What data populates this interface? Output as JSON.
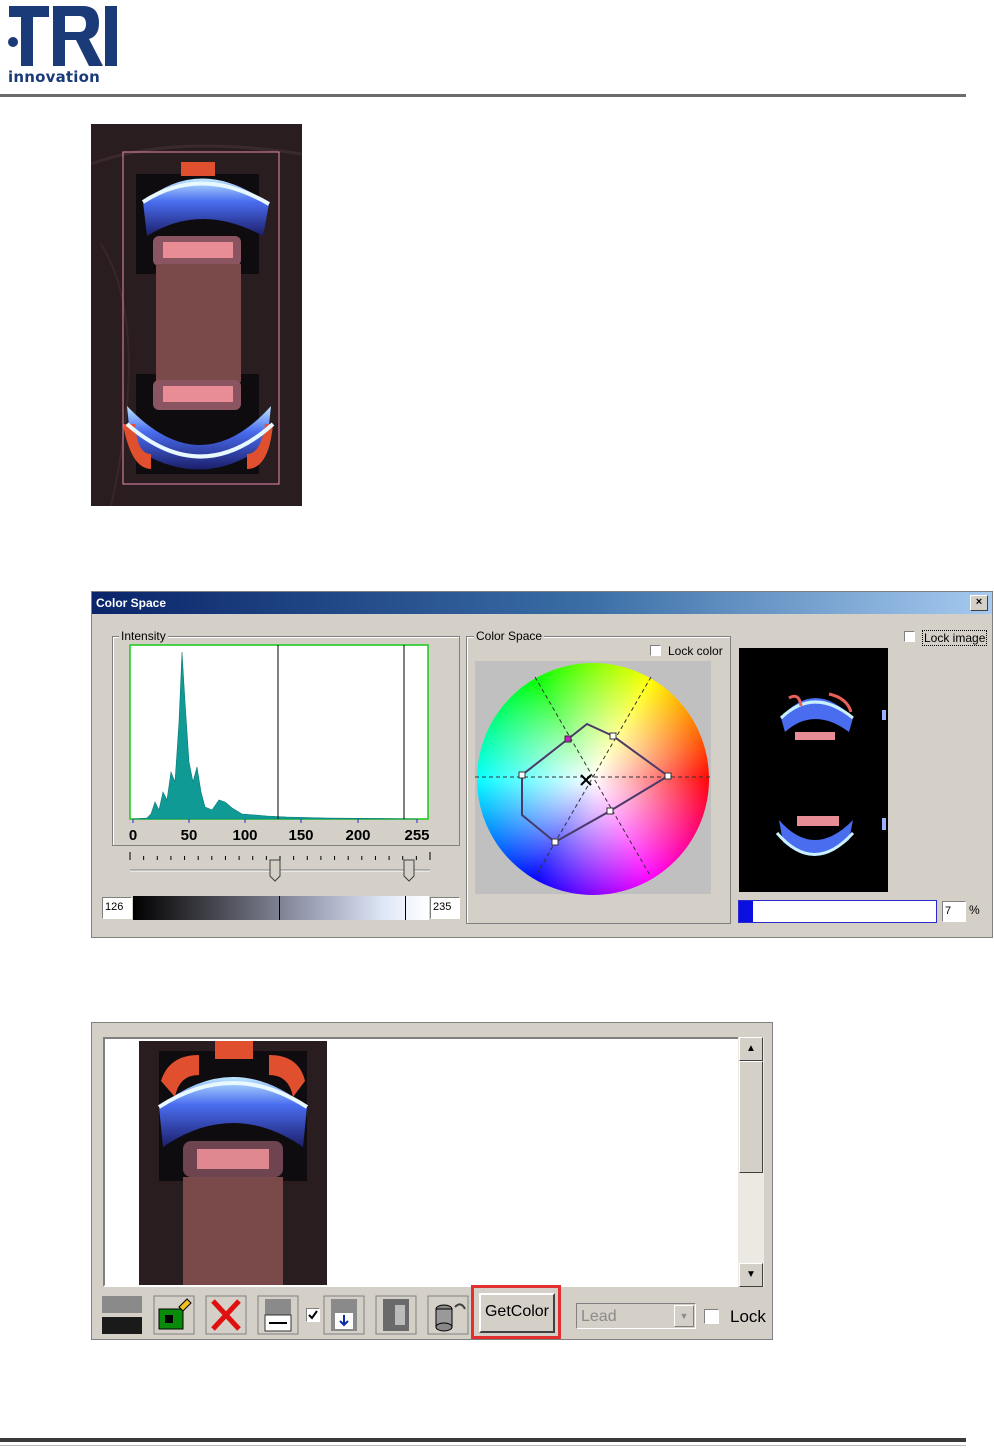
{
  "header": {
    "logo_brand": "TRI",
    "logo_sub": "innovation"
  },
  "dialog": {
    "title": "Color Space",
    "close": "×",
    "intensity": {
      "label": "Intensity",
      "axis_ticks": [
        "0",
        "50",
        "100",
        "150",
        "200",
        "255"
      ],
      "low_value": "126",
      "high_value": "235"
    },
    "color_space": {
      "label": "Color Space",
      "lock_color": "Lock color"
    },
    "preview": {
      "lock_image": "Lock image",
      "percent_value": "7",
      "percent_unit": "%",
      "progress": 0.07
    }
  },
  "toolbar": {
    "getcolor_label": "GetColor",
    "combo_value": "Lead",
    "lock_label": "Lock",
    "icons": [
      "layers-icon",
      "camera-edit-icon",
      "delete-icon",
      "measure-icon",
      "save-icon",
      "export-icon",
      "database-icon"
    ]
  },
  "colors": {
    "histogram": "#0f9a96",
    "plot_border": "#18c818",
    "highlight": "#e03030",
    "titlebar": "#0a246a"
  }
}
